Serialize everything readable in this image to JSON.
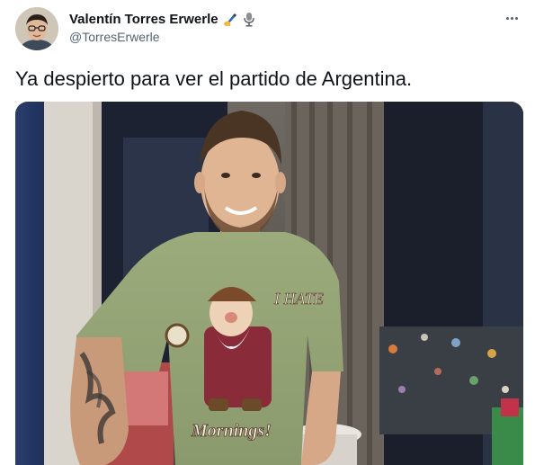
{
  "author": {
    "display_name": "Valentín Torres Erwerle",
    "handle": "@TorresErwerle",
    "badges": [
      "writing-hand-icon",
      "microphone-icon"
    ]
  },
  "tweet": {
    "text": "Ya despierto para ver el partido de Argentina."
  },
  "photo": {
    "shirt_text_top": "I HATE",
    "shirt_text_bottom": "Mornings!"
  },
  "colors": {
    "text_primary": "#0f1419",
    "text_secondary": "#536471",
    "background": "#ffffff"
  }
}
